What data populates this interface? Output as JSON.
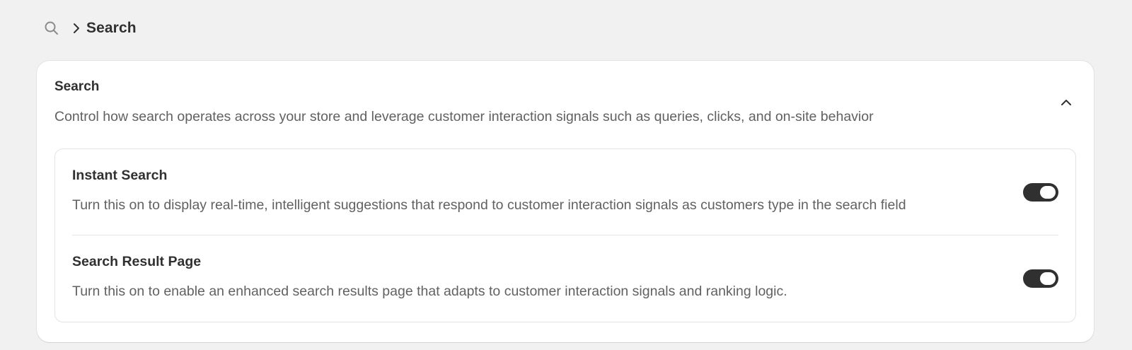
{
  "breadcrumb": {
    "root_icon": "search-icon",
    "separator_icon": "chevron-right-icon",
    "current": "Search"
  },
  "card": {
    "title": "Search",
    "description": "Control how search operates across your store and leverage customer interaction signals such as queries, clicks, and on-site behavior",
    "collapse_icon": "chevron-up-icon",
    "expanded": true,
    "settings": [
      {
        "title": "Instant Search",
        "description": "Turn this on to display real-time, intelligent suggestions that respond to customer interaction signals as customers type in the search field",
        "enabled": true
      },
      {
        "title": "Search Result Page",
        "description": "Turn this on to enable an enhanced search results page that adapts to customer interaction signals and ranking logic.",
        "enabled": true
      }
    ]
  },
  "colors": {
    "background": "#f1f1f1",
    "card": "#ffffff",
    "text_primary": "#303030",
    "text_secondary": "#616161",
    "toggle_on": "#303030",
    "border": "#e3e3e3"
  }
}
